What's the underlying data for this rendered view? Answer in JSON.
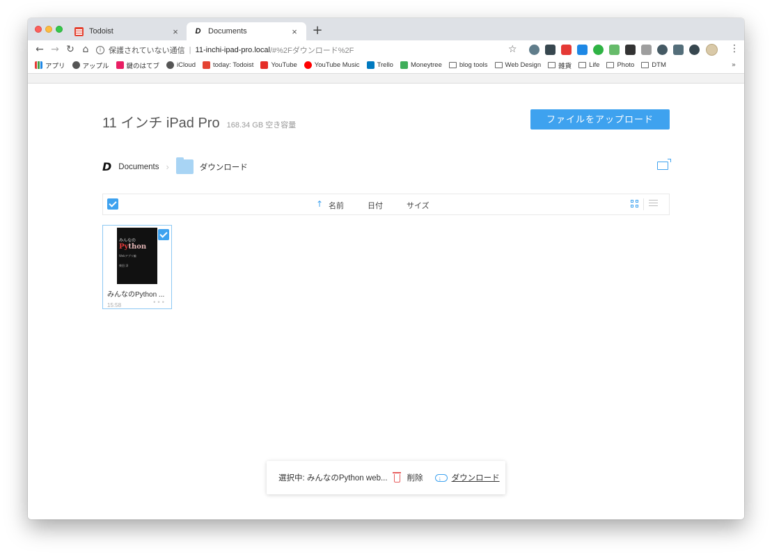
{
  "tabs": [
    {
      "title": "Todoist",
      "favicon": "todoist-icon"
    },
    {
      "title": "Documents",
      "favicon": "documents-d-icon"
    }
  ],
  "address_bar": {
    "security_label": "保護されていない通信",
    "separator": "|",
    "host": "11-inchi-ipad-pro.local",
    "path": "/#%2Fダウンロード%2F"
  },
  "bookmarks": [
    {
      "label": "アプリ",
      "icon": "apps-grid-icon",
      "color": "#e53935"
    },
    {
      "label": "アップル",
      "icon": "apple-icon",
      "color": "#555555"
    },
    {
      "label": "鍵のはてブ",
      "icon": "hatena-icon",
      "color": "#e91e63"
    },
    {
      "label": "iCloud",
      "icon": "apple-icon",
      "color": "#555555"
    },
    {
      "label": "today: Todoist",
      "icon": "todoist-icon",
      "color": "#e44332"
    },
    {
      "label": "YouTube",
      "icon": "youtube-icon",
      "color": "#e52d27"
    },
    {
      "label": "YouTube Music",
      "icon": "youtube-music-icon",
      "color": "#ff0000"
    },
    {
      "label": "Trello",
      "icon": "trello-icon",
      "color": "#0079bf"
    },
    {
      "label": "Moneytree",
      "icon": "moneytree-icon",
      "color": "#3fae5a"
    },
    {
      "label": "blog tools",
      "icon": "folder-icon",
      "color": ""
    },
    {
      "label": "Web Design",
      "icon": "folder-icon",
      "color": ""
    },
    {
      "label": "雑貨",
      "icon": "folder-icon",
      "color": ""
    },
    {
      "label": "Life",
      "icon": "folder-icon",
      "color": ""
    },
    {
      "label": "Photo",
      "icon": "folder-icon",
      "color": ""
    },
    {
      "label": "DTM",
      "icon": "folder-icon",
      "color": ""
    }
  ],
  "bookmarks_more": "»",
  "device": {
    "name": "11 インチ iPad Pro",
    "free_space": "168.34 GB 空き容量"
  },
  "upload_button": "ファイルをアップロード",
  "breadcrumb": {
    "root": "Documents",
    "current": "ダウンロード"
  },
  "columns": {
    "name": "名前",
    "date": "日付",
    "size": "サイズ",
    "sort_indicator": "↑"
  },
  "files": [
    {
      "name": "みんなのPython ...",
      "time": "15:58",
      "more": "•••",
      "thumbnail": {
        "line1": "みんなの",
        "line2a": "Py",
        "line2b": "thon",
        "line3": "Webアプリ編",
        "line4": "柴田 淳"
      },
      "selected": true
    }
  ],
  "action_bar": {
    "selected_text": "選択中: みんなのPython web...",
    "delete_label": "削除",
    "download_label": "ダウンロード"
  },
  "colors": {
    "accent": "#3ea2ef",
    "danger": "#e85d5d"
  }
}
